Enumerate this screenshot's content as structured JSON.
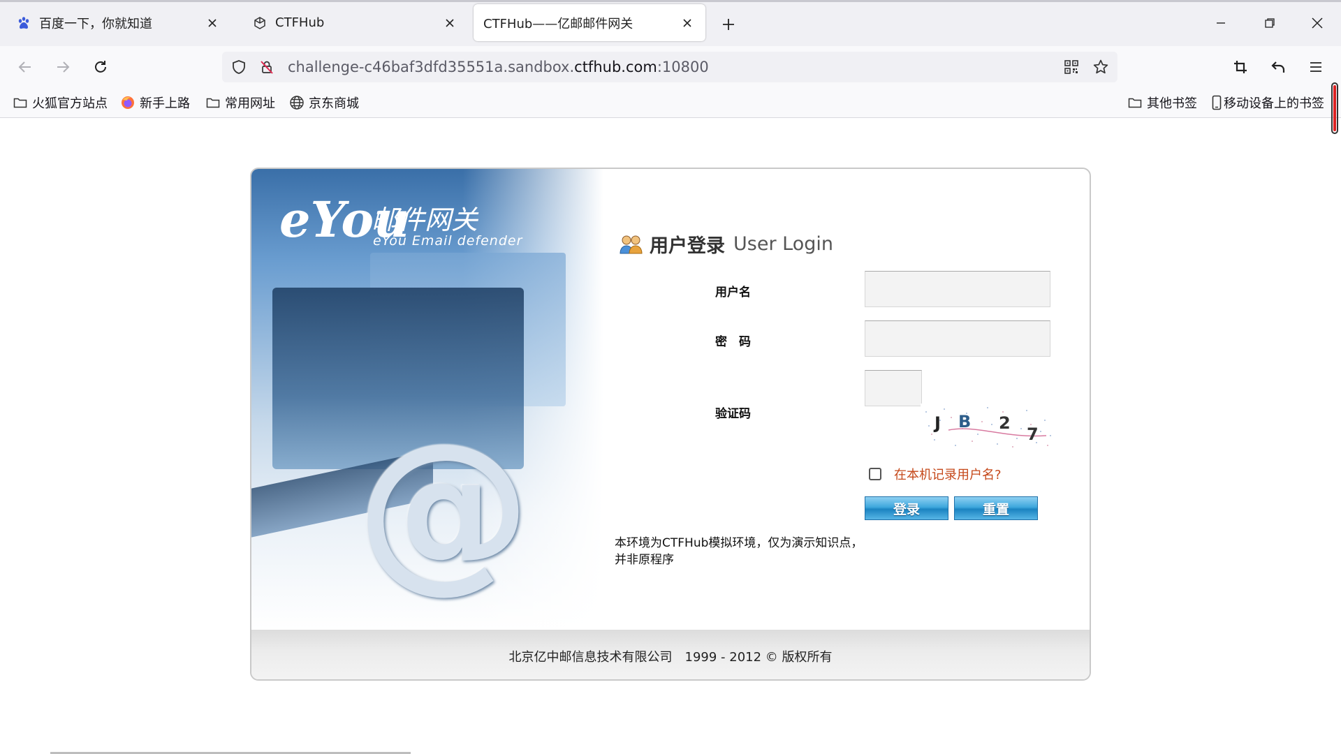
{
  "browser": {
    "tabs": [
      {
        "title": "百度一下，你就知道",
        "active": false
      },
      {
        "title": "CTFHub",
        "active": false
      },
      {
        "title": "CTFHub——亿邮邮件网关",
        "active": true
      }
    ],
    "url_prefix": "challenge-c46baf3dfd35551a.sandbox.",
    "url_host": "ctfhub.com",
    "url_port": ":10800",
    "bookmarks_left": [
      "火狐官方站点",
      "新手上路",
      "常用网址",
      "京东商城"
    ],
    "bookmarks_right": [
      "其他书签",
      "移动设备上的书签"
    ]
  },
  "login": {
    "logo_mark": "eYou",
    "logo_cn": "邮件网关",
    "logo_en": "eYou Email defender",
    "heading_cn": "用户登录",
    "heading_en": "User Login",
    "username_label": "用户名",
    "password_label": "密　码",
    "captcha_label": "验证码",
    "captcha_text": "JB27",
    "remember_label": "在本机记录用户名?",
    "login_button": "登录",
    "reset_button": "重置",
    "note": "本环境为CTFHub模拟环境，仅为演示知识点，并非原程序",
    "footer": "北京亿中邮信息技术有限公司　1999 - 2012 © 版权所有"
  },
  "colors": {
    "remember_text": "#c5481a",
    "button_blue": "#2a95d0"
  }
}
